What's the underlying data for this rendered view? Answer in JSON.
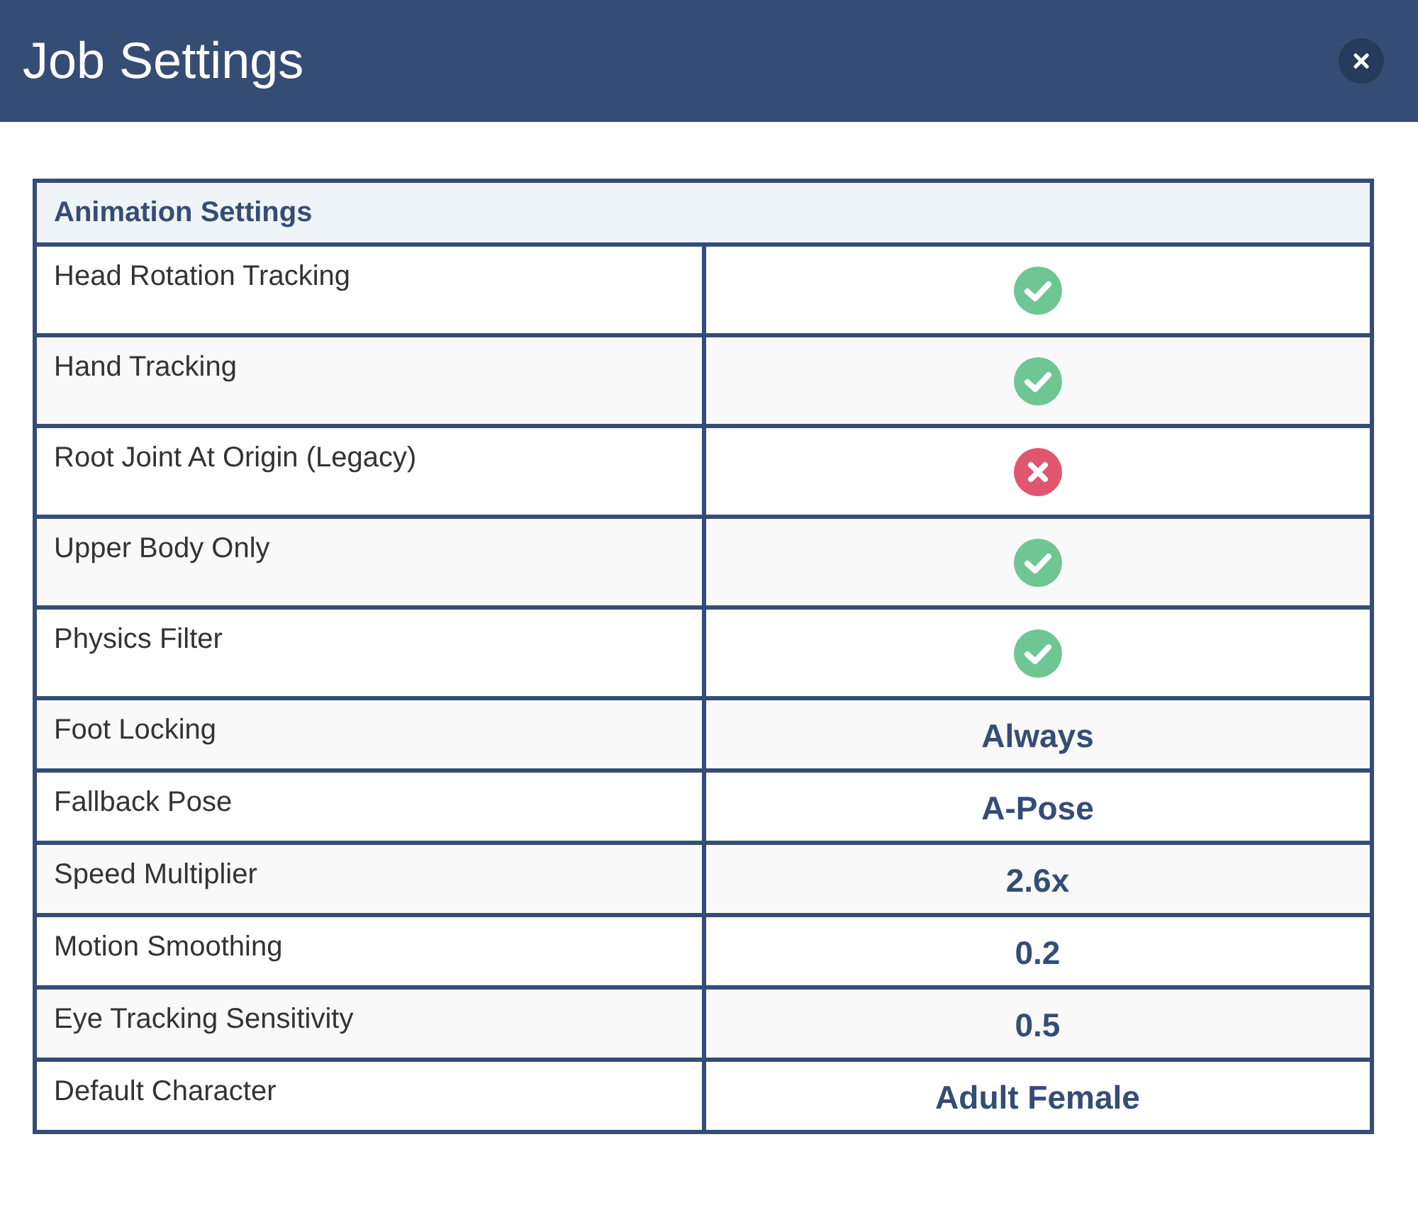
{
  "window": {
    "title": "Job Settings"
  },
  "section": {
    "title": "Animation Settings",
    "rows": [
      {
        "label": "Head Rotation Tracking",
        "kind": "toggle",
        "enabled": true
      },
      {
        "label": "Hand Tracking",
        "kind": "toggle",
        "enabled": true
      },
      {
        "label": "Root Joint At Origin (Legacy)",
        "kind": "toggle",
        "enabled": false
      },
      {
        "label": "Upper Body Only",
        "kind": "toggle",
        "enabled": true
      },
      {
        "label": "Physics Filter",
        "kind": "toggle",
        "enabled": true
      },
      {
        "label": "Foot Locking",
        "kind": "text",
        "value": "Always"
      },
      {
        "label": "Fallback Pose",
        "kind": "text",
        "value": "A-Pose"
      },
      {
        "label": "Speed Multiplier",
        "kind": "text",
        "value": "2.6x"
      },
      {
        "label": "Motion Smoothing",
        "kind": "text",
        "value": "0.2"
      },
      {
        "label": "Eye Tracking Sensitivity",
        "kind": "text",
        "value": "0.5"
      },
      {
        "label": "Default Character",
        "kind": "text",
        "value": "Adult Female"
      }
    ]
  }
}
